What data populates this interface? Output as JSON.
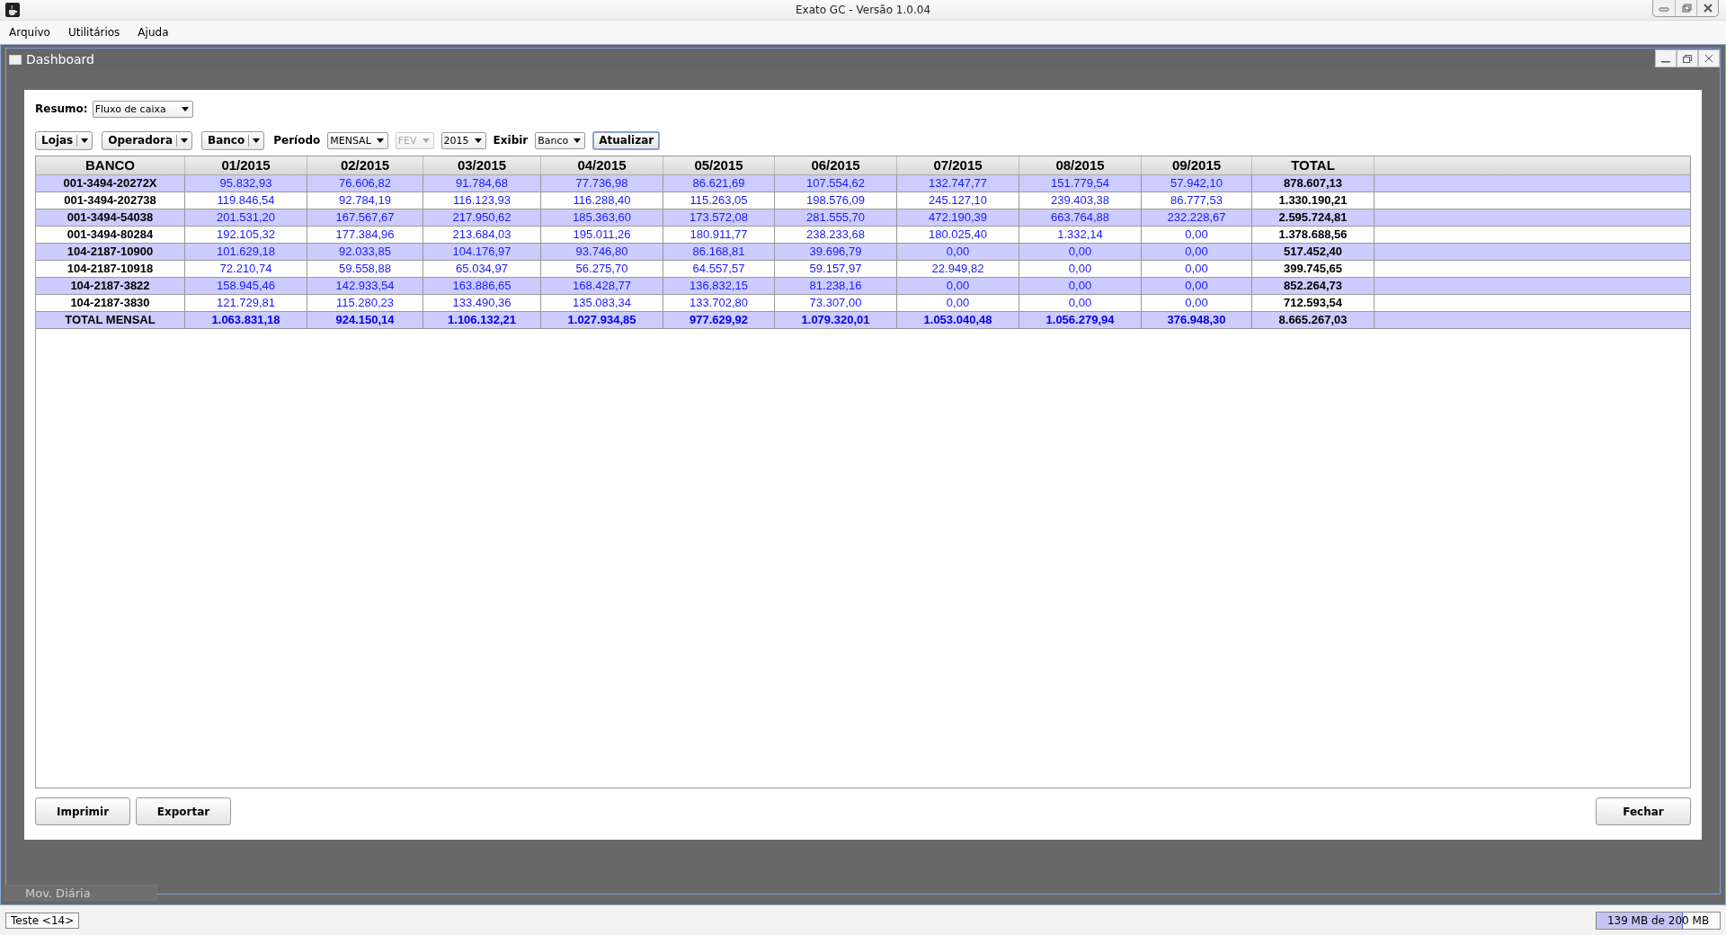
{
  "window": {
    "title": "Exato GC - Versão 1.0.04"
  },
  "menu": [
    "Arquivo",
    "Utilitários",
    "Ajuda"
  ],
  "frame": {
    "title": "Dashboard"
  },
  "resumo": {
    "label": "Resumo:",
    "value": "Fluxo de caixa"
  },
  "filters": [
    {
      "kind": "split",
      "label": "Lojas"
    },
    {
      "kind": "split",
      "label": "Operadora"
    },
    {
      "kind": "split",
      "label": "Banco"
    },
    {
      "kind": "label",
      "label": "Período"
    },
    {
      "kind": "combo",
      "label": "MENSAL",
      "disabled": false
    },
    {
      "kind": "combo",
      "label": "FEV",
      "disabled": true
    },
    {
      "kind": "combo",
      "label": "2015",
      "disabled": false
    },
    {
      "kind": "label",
      "label": "Exibir"
    },
    {
      "kind": "combo",
      "label": "Banco",
      "disabled": false
    },
    {
      "kind": "button",
      "label": "Atualizar"
    }
  ],
  "table": {
    "columns": [
      "BANCO",
      "01/2015",
      "02/2015",
      "03/2015",
      "04/2015",
      "05/2015",
      "06/2015",
      "07/2015",
      "08/2015",
      "09/2015",
      "TOTAL"
    ],
    "rows": [
      {
        "kind": "account",
        "cells": [
          "001-3494-20272X",
          "95.832,93",
          "76.606,82",
          "91.784,68",
          "77.736,98",
          "86.621,69",
          "107.554,62",
          "132.747,77",
          "151.779,54",
          "57.942,10",
          "878.607,13"
        ]
      },
      {
        "kind": "account",
        "cells": [
          "001-3494-202738",
          "119.846,54",
          "92.784,19",
          "116.123,93",
          "116.288,40",
          "115.263,05",
          "198.576,09",
          "245.127,10",
          "239.403,38",
          "86.777,53",
          "1.330.190,21"
        ]
      },
      {
        "kind": "account",
        "cells": [
          "001-3494-54038",
          "201.531,20",
          "167.567,67",
          "217.950,62",
          "185.363,60",
          "173.572,08",
          "281.555,70",
          "472.190,39",
          "663.764,88",
          "232.228,67",
          "2.595.724,81"
        ]
      },
      {
        "kind": "account",
        "cells": [
          "001-3494-80284",
          "192.105,32",
          "177.384,96",
          "213.684,03",
          "195.011,26",
          "180.911,77",
          "238.233,68",
          "180.025,40",
          "1.332,14",
          "0,00",
          "1.378.688,56"
        ]
      },
      {
        "kind": "account",
        "cells": [
          "104-2187-10900",
          "101.629,18",
          "92.033,85",
          "104.176,97",
          "93.746,80",
          "86.168,81",
          "39.696,79",
          "0,00",
          "0,00",
          "0,00",
          "517.452,40"
        ]
      },
      {
        "kind": "account",
        "cells": [
          "104-2187-10918",
          "72.210,74",
          "59.558,88",
          "65.034,97",
          "56.275,70",
          "64.557,57",
          "59.157,97",
          "22.949,82",
          "0,00",
          "0,00",
          "399.745,65"
        ]
      },
      {
        "kind": "account",
        "cells": [
          "104-2187-3822",
          "158.945,46",
          "142.933,54",
          "163.886,65",
          "168.428,77",
          "136.832,15",
          "81.238,16",
          "0,00",
          "0,00",
          "0,00",
          "852.264,73"
        ]
      },
      {
        "kind": "account",
        "cells": [
          "104-2187-3830",
          "121.729,81",
          "115.280,23",
          "133.490,36",
          "135.083,34",
          "133.702,80",
          "73.307,00",
          "0,00",
          "0,00",
          "0,00",
          "712.593,54"
        ]
      },
      {
        "kind": "total",
        "cells": [
          "TOTAL MENSAL",
          "1.063.831,18",
          "924.150,14",
          "1.106.132,21",
          "1.027.934,85",
          "977.629,92",
          "1.079.320,01",
          "1.053.040,48",
          "1.056.279,94",
          "376.948,30",
          "8.665.267,03"
        ]
      }
    ]
  },
  "actions_left": [
    "Imprimir",
    "Exportar"
  ],
  "actions_right": [
    "Fechar"
  ],
  "minimized_frames": [
    {
      "title": "Mov. Diária"
    }
  ],
  "status_bar": {
    "user": "Teste <14>",
    "memory": {
      "text": "139 MB de 200 MB",
      "level": 0.695
    }
  }
}
